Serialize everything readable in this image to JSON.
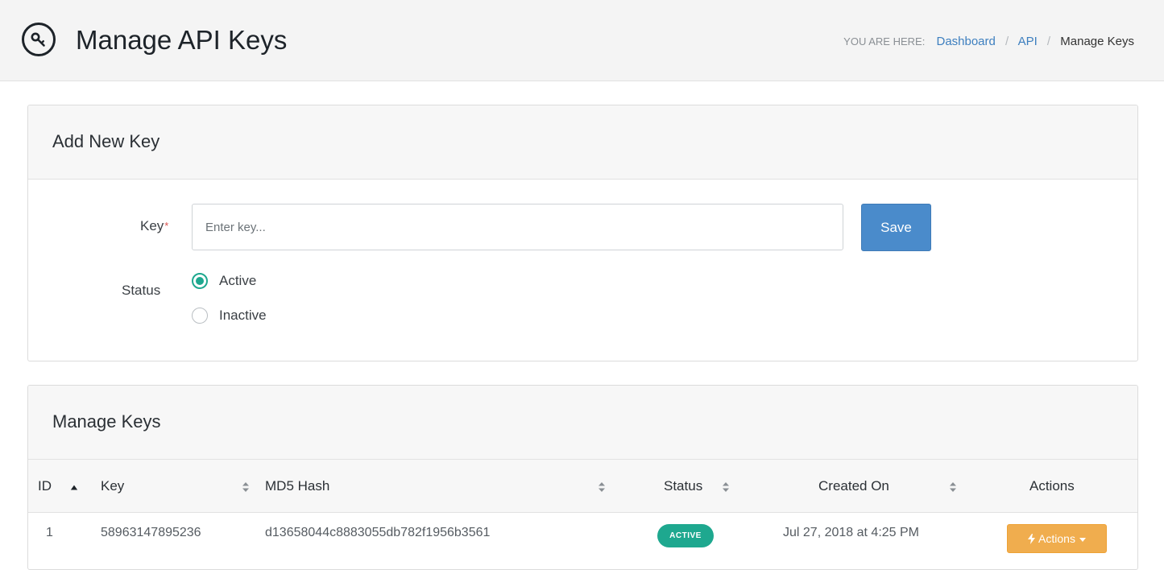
{
  "header": {
    "title": "Manage API Keys",
    "icon": "key-icon",
    "breadcrumb": {
      "lead": "YOU ARE HERE:",
      "items": [
        "Dashboard",
        "API",
        "Manage Keys"
      ],
      "separator": "/"
    }
  },
  "add_panel": {
    "title": "Add New Key",
    "key_label": "Key",
    "required_mark": "*",
    "key_placeholder": "Enter key...",
    "key_value": "",
    "save_label": "Save",
    "status_label": "Status",
    "status_options": [
      {
        "label": "Active",
        "checked": true
      },
      {
        "label": "Inactive",
        "checked": false
      }
    ]
  },
  "manage_panel": {
    "title": "Manage Keys",
    "columns": [
      "ID",
      "Key",
      "MD5 Hash",
      "Status",
      "Created On",
      "Actions"
    ],
    "sorted_column": "ID",
    "sort_direction": "asc",
    "rows": [
      {
        "id": "1",
        "key": "58963147895236",
        "md5": "d13658044c8883055db782f1956b3561",
        "status": "ACTIVE",
        "created_on": "Jul 27, 2018 at 4:25 PM",
        "actions_label": "Actions"
      }
    ]
  },
  "colors": {
    "accent_blue": "#4a8bcb",
    "active_green": "#1ea88f",
    "actions_orange": "#f0ad4e",
    "link": "#3d7fbf"
  }
}
